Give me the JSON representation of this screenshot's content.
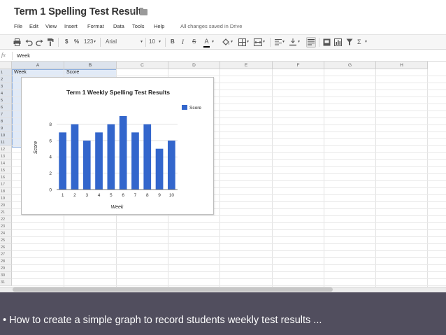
{
  "document": {
    "title": "Term 1 Spelling Test Results"
  },
  "menu": {
    "items": [
      "File",
      "Edit",
      "View",
      "Insert",
      "Format",
      "Data",
      "Tools",
      "Help"
    ],
    "save_status": "All changes saved in Drive"
  },
  "toolbar": {
    "currency": "$",
    "percent": "%",
    "number_format": "123",
    "font": "Arial",
    "font_size": "10",
    "bold": "B",
    "italic": "I",
    "strikethrough": "S",
    "text_color": "A",
    "sum": "Σ",
    "dropdown_caret": "▾"
  },
  "formula_bar": {
    "fx": "fx",
    "content": "Week"
  },
  "sheet": {
    "columns": [
      "A",
      "B",
      "C",
      "D",
      "E",
      "F",
      "G",
      "H"
    ],
    "rows": [
      "1",
      "2",
      "3",
      "4",
      "5",
      "6",
      "7",
      "8",
      "9",
      "10",
      "11",
      "12",
      "13",
      "14",
      "15",
      "16",
      "17",
      "18",
      "19",
      "20",
      "21",
      "22",
      "23",
      "24",
      "25",
      "26",
      "27",
      "28",
      "29",
      "30",
      "31"
    ],
    "cells": {
      "A1": "Week",
      "B1": "Score"
    }
  },
  "chart_data": {
    "type": "bar",
    "title": "Term 1 Weekly Spelling Test Results",
    "xlabel": "Week",
    "ylabel": "Score",
    "categories": [
      "1",
      "2",
      "3",
      "4",
      "5",
      "6",
      "7",
      "8",
      "9",
      "10"
    ],
    "series": [
      {
        "name": "Score",
        "values": [
          7,
          8,
          6,
          7,
          8,
          9,
          7,
          8,
          5,
          6
        ],
        "color": "#3366cc"
      }
    ],
    "ylim": [
      0,
      9
    ],
    "yticks": [
      "0",
      "2",
      "4",
      "6",
      "8"
    ],
    "grid": true,
    "legend": "right"
  },
  "caption": {
    "text": "• How to create a simple graph to record students weekly test results ..."
  },
  "colors": {
    "accent": "#3366cc",
    "caption_bg": "#514e5e",
    "selection": "#c8d8f0"
  }
}
